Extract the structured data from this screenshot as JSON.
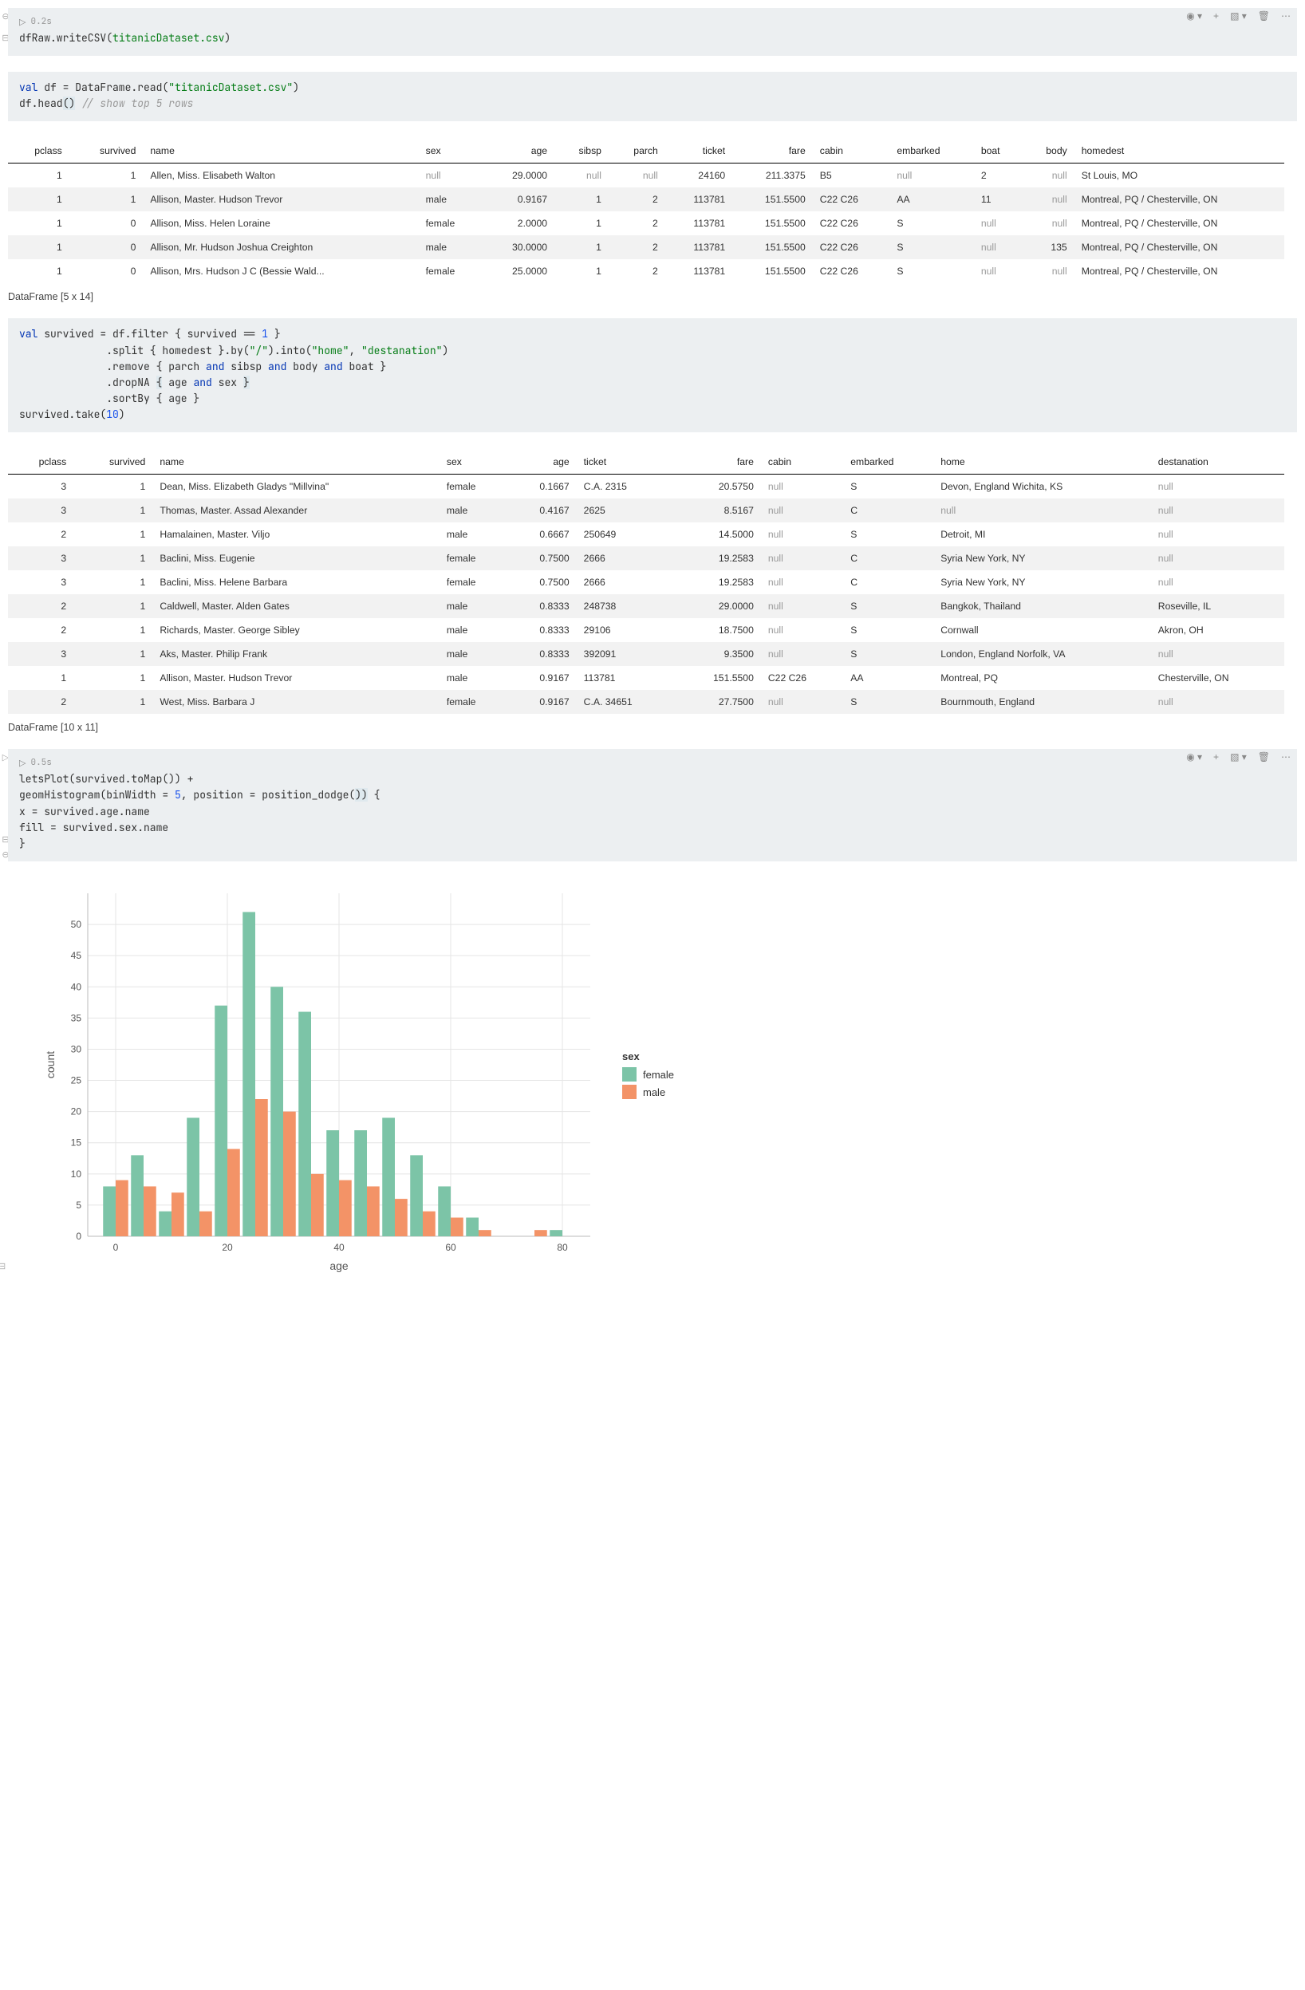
{
  "colors": {
    "female": "#7cc4a7",
    "male": "#f39367"
  },
  "cell1": {
    "runtime": "0.2s",
    "code_line": "dfRaw.writeCSV(\"titanicDataset.csv\")",
    "filename": "titanicDataset.csv"
  },
  "cell2": {
    "code_l1_a": "val df = DataFrame.read(",
    "code_l1_str": "\"titanicDataset.csv\"",
    "code_l1_b": ")",
    "code_l2_a": "df.head()",
    "code_l2_b": " // show top 5 rows"
  },
  "table1": {
    "headers": [
      "pclass",
      "survived",
      "name",
      "sex",
      "age",
      "sibsp",
      "parch",
      "ticket",
      "fare",
      "cabin",
      "embarked",
      "boat",
      "body",
      "homedest"
    ],
    "rows": [
      [
        "1",
        "1",
        "Allen, Miss. Elisabeth Walton",
        null,
        "29.0000",
        null,
        null,
        "24160",
        "211.3375",
        "B5",
        null,
        "2",
        null,
        "St Louis, MO"
      ],
      [
        "1",
        "1",
        "Allison, Master. Hudson Trevor",
        "male",
        "0.9167",
        "1",
        "2",
        "113781",
        "151.5500",
        "C22 C26",
        "AA",
        "11",
        null,
        "Montreal, PQ / Chesterville, ON"
      ],
      [
        "1",
        "0",
        "Allison, Miss. Helen Loraine",
        "female",
        "2.0000",
        "1",
        "2",
        "113781",
        "151.5500",
        "C22 C26",
        "S",
        null,
        null,
        "Montreal, PQ / Chesterville, ON"
      ],
      [
        "1",
        "0",
        "Allison, Mr. Hudson Joshua Creighton",
        "male",
        "30.0000",
        "1",
        "2",
        "113781",
        "151.5500",
        "C22 C26",
        "S",
        null,
        "135",
        "Montreal, PQ / Chesterville, ON"
      ],
      [
        "1",
        "0",
        "Allison, Mrs. Hudson J C (Bessie Wald...",
        "female",
        "25.0000",
        "1",
        "2",
        "113781",
        "151.5500",
        "C22 C26",
        "S",
        null,
        null,
        "Montreal, PQ / Chesterville, ON"
      ]
    ],
    "summary": "DataFrame [5 x 14]"
  },
  "cell3": {
    "l1": "val survived = df.filter { survived == 1 }",
    "l2a": "              .split { homedest }.by(",
    "l2s1": "\"/\"",
    "l2b": ").into(",
    "l2s2": "\"home\"",
    "l2c": ", ",
    "l2s3": "\"destanation\"",
    "l2d": ")",
    "l3": "              .remove { parch and sibsp and body and boat }",
    "l4": "              .dropNA { age and sex }",
    "l5": "              .sortBy { age }",
    "l6": "survived.take(10)"
  },
  "table2": {
    "headers": [
      "pclass",
      "survived",
      "name",
      "sex",
      "age",
      "ticket",
      "fare",
      "cabin",
      "embarked",
      "home",
      "destanation"
    ],
    "rows": [
      [
        "3",
        "1",
        "Dean, Miss. Elizabeth Gladys \"Millvina\"",
        "female",
        "0.1667",
        "C.A. 2315",
        "20.5750",
        null,
        "S",
        "Devon, England Wichita, KS",
        null
      ],
      [
        "3",
        "1",
        "Thomas, Master. Assad Alexander",
        "male",
        "0.4167",
        "2625",
        "8.5167",
        null,
        "C",
        null,
        null
      ],
      [
        "2",
        "1",
        "Hamalainen, Master. Viljo",
        "male",
        "0.6667",
        "250649",
        "14.5000",
        null,
        "S",
        "Detroit, MI",
        null
      ],
      [
        "3",
        "1",
        "Baclini, Miss. Eugenie",
        "female",
        "0.7500",
        "2666",
        "19.2583",
        null,
        "C",
        "Syria New York, NY",
        null
      ],
      [
        "3",
        "1",
        "Baclini, Miss. Helene Barbara",
        "female",
        "0.7500",
        "2666",
        "19.2583",
        null,
        "C",
        "Syria New York, NY",
        null
      ],
      [
        "2",
        "1",
        "Caldwell, Master. Alden Gates",
        "male",
        "0.8333",
        "248738",
        "29.0000",
        null,
        "S",
        "Bangkok, Thailand",
        "Roseville, IL"
      ],
      [
        "2",
        "1",
        "Richards, Master. George Sibley",
        "male",
        "0.8333",
        "29106",
        "18.7500",
        null,
        "S",
        "Cornwall",
        "Akron, OH"
      ],
      [
        "3",
        "1",
        "Aks, Master. Philip Frank",
        "male",
        "0.8333",
        "392091",
        "9.3500",
        null,
        "S",
        "London, England Norfolk, VA",
        null
      ],
      [
        "1",
        "1",
        "Allison, Master. Hudson Trevor",
        "male",
        "0.9167",
        "113781",
        "151.5500",
        "C22 C26",
        "AA",
        "Montreal, PQ",
        "Chesterville, ON"
      ],
      [
        "2",
        "1",
        "West, Miss. Barbara J",
        "female",
        "0.9167",
        "C.A. 34651",
        "27.7500",
        null,
        "S",
        "Bournmouth, England",
        null
      ]
    ],
    "summary": "DataFrame [10 x 11]"
  },
  "cell4": {
    "runtime": "0.5s",
    "l1": "letsPlot(survived.toMap()) +",
    "l2a": "geomHistogram(binWidth = ",
    "l2n": "5",
    "l2b": ", position = position_dodge()) {",
    "l3": "    x = survived.age.name",
    "l4": "    fill = survived.sex.name",
    "l5": "}"
  },
  "chart_data": {
    "type": "bar",
    "title": "",
    "xlabel": "age",
    "ylabel": "count",
    "xlim": [
      -5,
      85
    ],
    "ylim": [
      0,
      55
    ],
    "x_ticks": [
      0,
      20,
      40,
      60,
      80
    ],
    "y_ticks": [
      0,
      5,
      10,
      15,
      20,
      25,
      30,
      35,
      40,
      45,
      50
    ],
    "categories": [
      0,
      5,
      10,
      15,
      20,
      25,
      30,
      35,
      40,
      45,
      50,
      55,
      60,
      65,
      75,
      80
    ],
    "series": [
      {
        "name": "female",
        "values": [
          8,
          13,
          4,
          19,
          37,
          52,
          40,
          36,
          17,
          17,
          19,
          13,
          8,
          3,
          0,
          1
        ]
      },
      {
        "name": "male",
        "values": [
          9,
          8,
          7,
          4,
          14,
          22,
          20,
          10,
          9,
          8,
          6,
          4,
          3,
          1,
          1,
          0
        ]
      }
    ],
    "legend_title": "sex",
    "legend": [
      "female",
      "male"
    ]
  }
}
